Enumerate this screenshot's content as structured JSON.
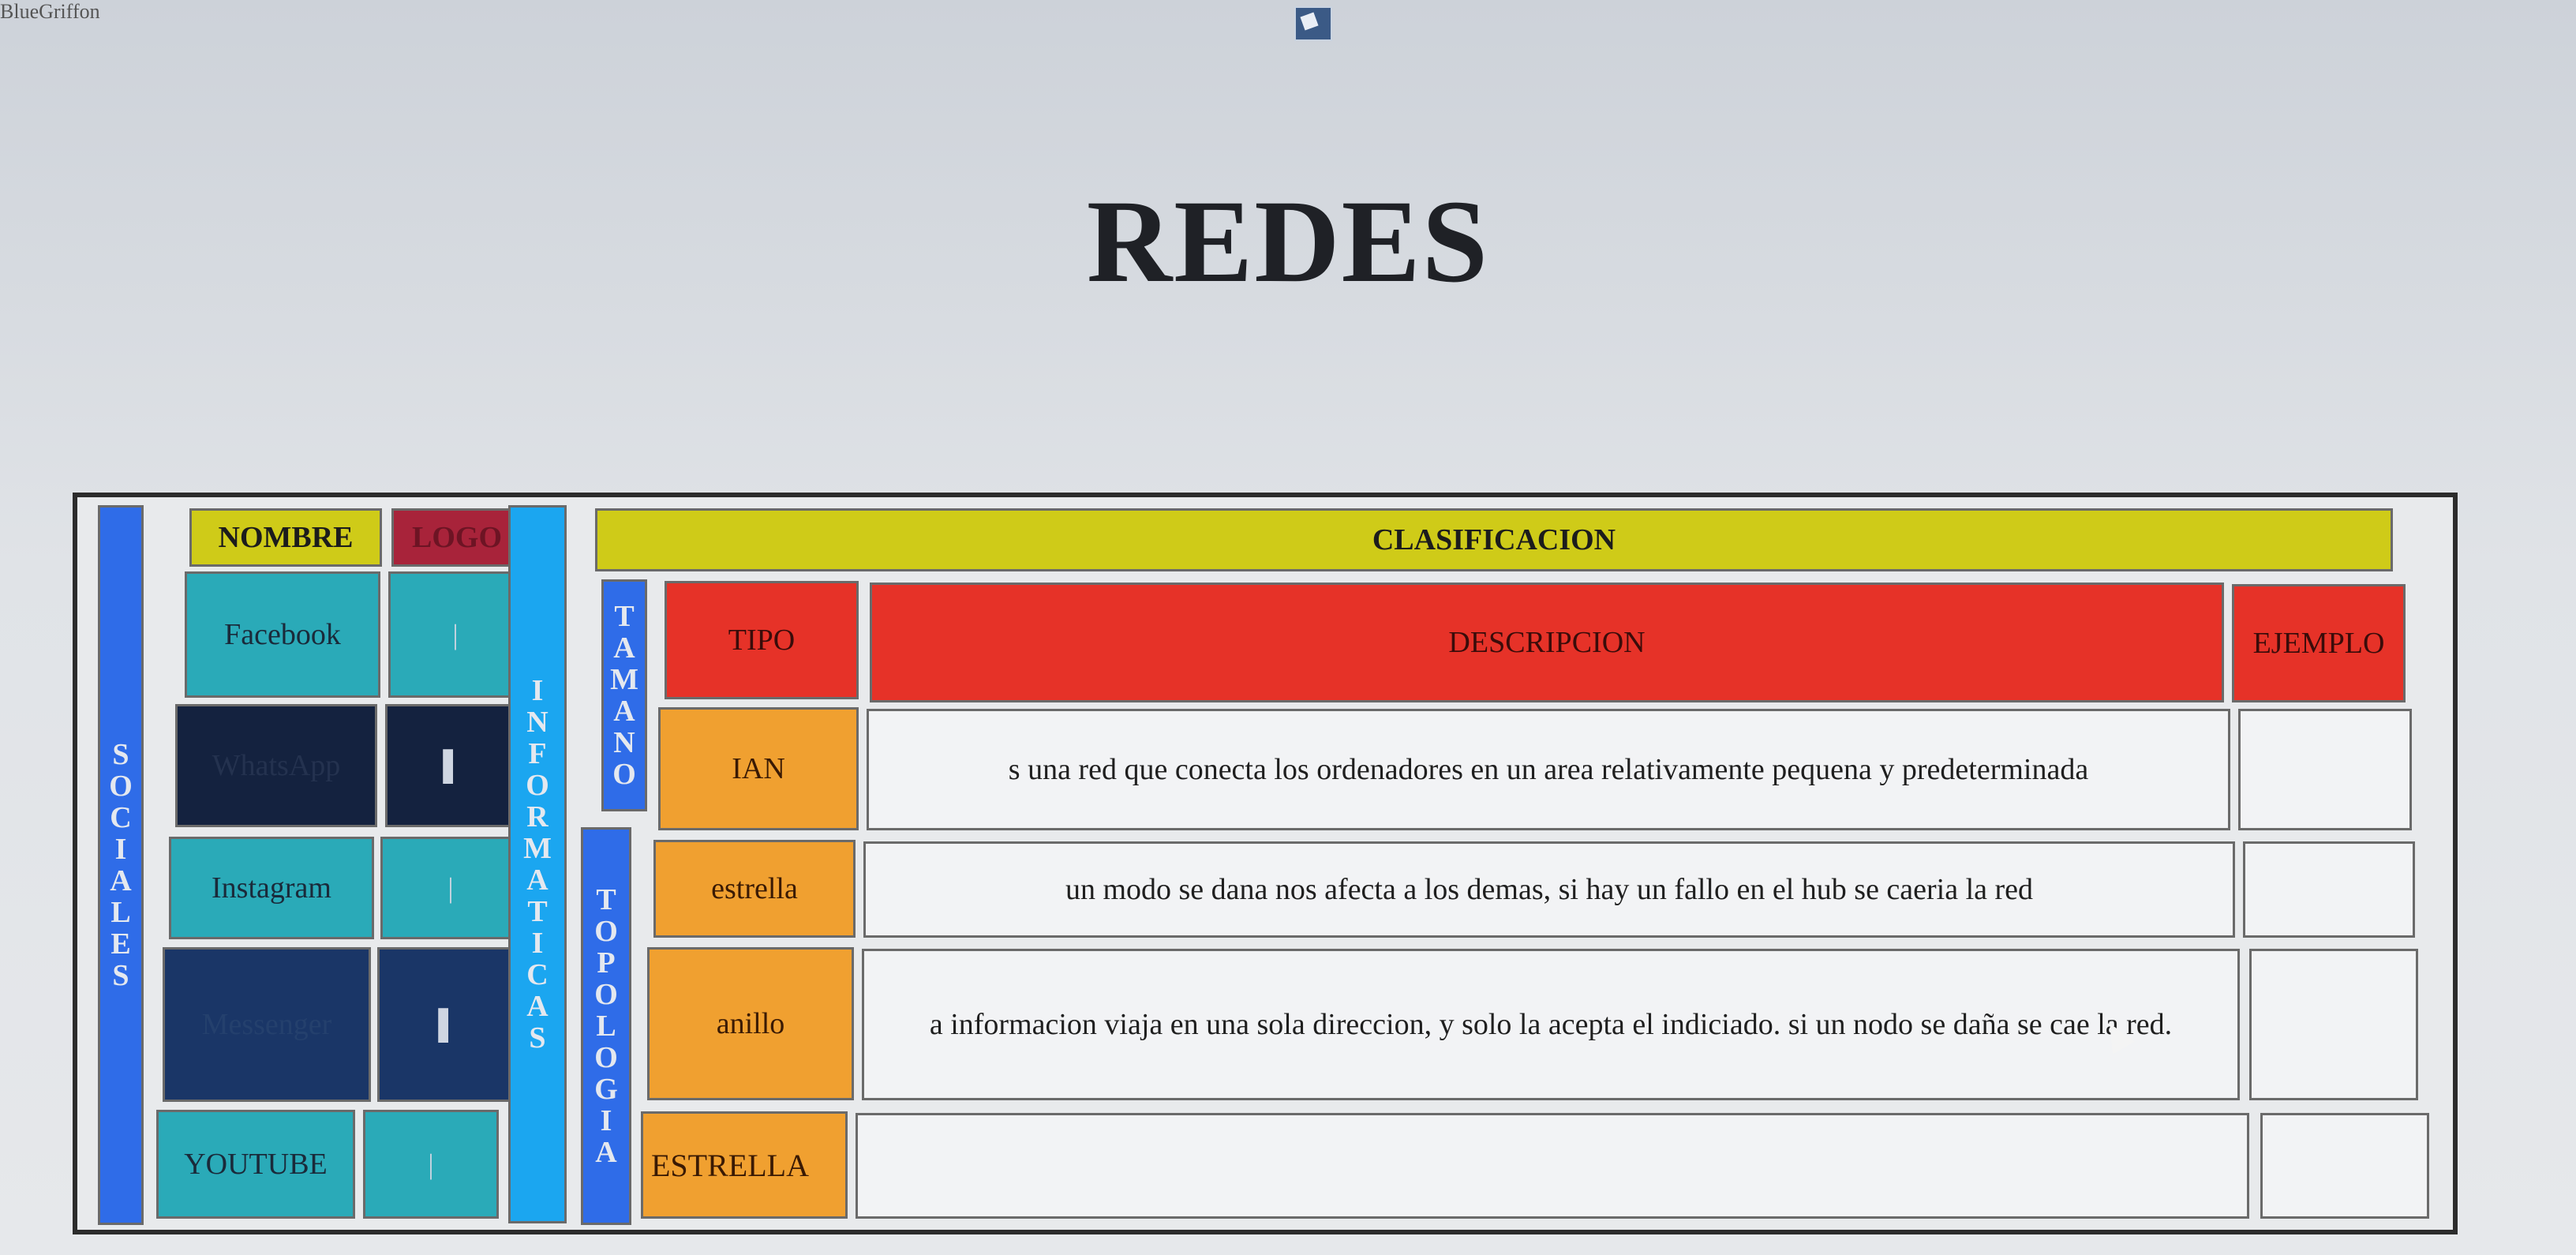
{
  "app": {
    "name": "BlueGriffon"
  },
  "page": {
    "title": "REDES"
  },
  "table": {
    "sociales_label": "SOCIALES",
    "informaticas_label": "INFORMATICAS",
    "tamano_label": "TAMANO",
    "topologia_label": "TOPOLOGIA",
    "nombre_header": "NOMBRE",
    "logo_header": "LOGO",
    "clasificacion_header": "CLASIFICACION",
    "tipo_header": "TIPO",
    "descripcion_header": "DESCRIPCION",
    "ejemplo_header": "EJEMPLO",
    "social_names": [
      "Facebook",
      "WhatsApp",
      "Instagram",
      "Messenger",
      "YOUTUBE"
    ],
    "rows": [
      {
        "tipo": "IAN",
        "descripcion": "s una red que conecta los ordenadores en un area relativamente pequena y predeterminada",
        "ejemplo": ""
      },
      {
        "tipo": "estrella",
        "descripcion": "un modo se dana nos afecta a los demas, si hay un fallo en el hub se caeria la red",
        "ejemplo": ""
      },
      {
        "tipo": "anillo",
        "descripcion": "a informacion viaja en una sola direccion, y solo la acepta el indiciado. si un nodo se daña se cae la red.",
        "ejemplo": ""
      },
      {
        "tipo": "ESTRELLA",
        "descripcion": "",
        "ejemplo": ""
      }
    ]
  },
  "colors": {
    "blue_bar": "#2f6ce8",
    "cyan_bar": "#1ba6f0",
    "header_yellow": "#cfcb18",
    "header_red": "#e63228",
    "tipo_orange": "#f0a030",
    "teal": "#2aaab8",
    "navy": "#14223f"
  }
}
